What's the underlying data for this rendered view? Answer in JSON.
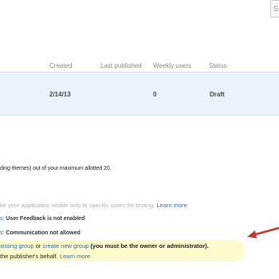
{
  "toolbar": {
    "scroll_label": "S"
  },
  "table": {
    "headers": [
      "Created",
      "Last published",
      "Weekly users",
      "Status"
    ],
    "row": {
      "created": "2/14/13",
      "last_published": "",
      "weekly_users": "0",
      "status": "Draft"
    }
  },
  "quota_text": "ding themes) out of your maximum allotted 20.",
  "testing": {
    "text": "ke your application visible only to specific users for testing. ",
    "learn_more": "Learn more"
  },
  "settings": [
    {
      "prefix": "s:",
      "text": "User Feedback is not enabled"
    },
    {
      "prefix": "s:",
      "text": "Communication not allowed"
    }
  ],
  "highlight": {
    "line1_link1": "xisting group",
    "line1_or": " or ",
    "line1_link2": "create new group",
    "line1_rest": " (you must be the owner or administrator).",
    "line2_text": "the publisher's behalf. ",
    "line2_link": "Learn more"
  },
  "colors": {
    "link": "#2a6fb5",
    "highlight": "#fdfacb",
    "arrow": "#c0392b",
    "row_bg": "#eaf3fb"
  }
}
